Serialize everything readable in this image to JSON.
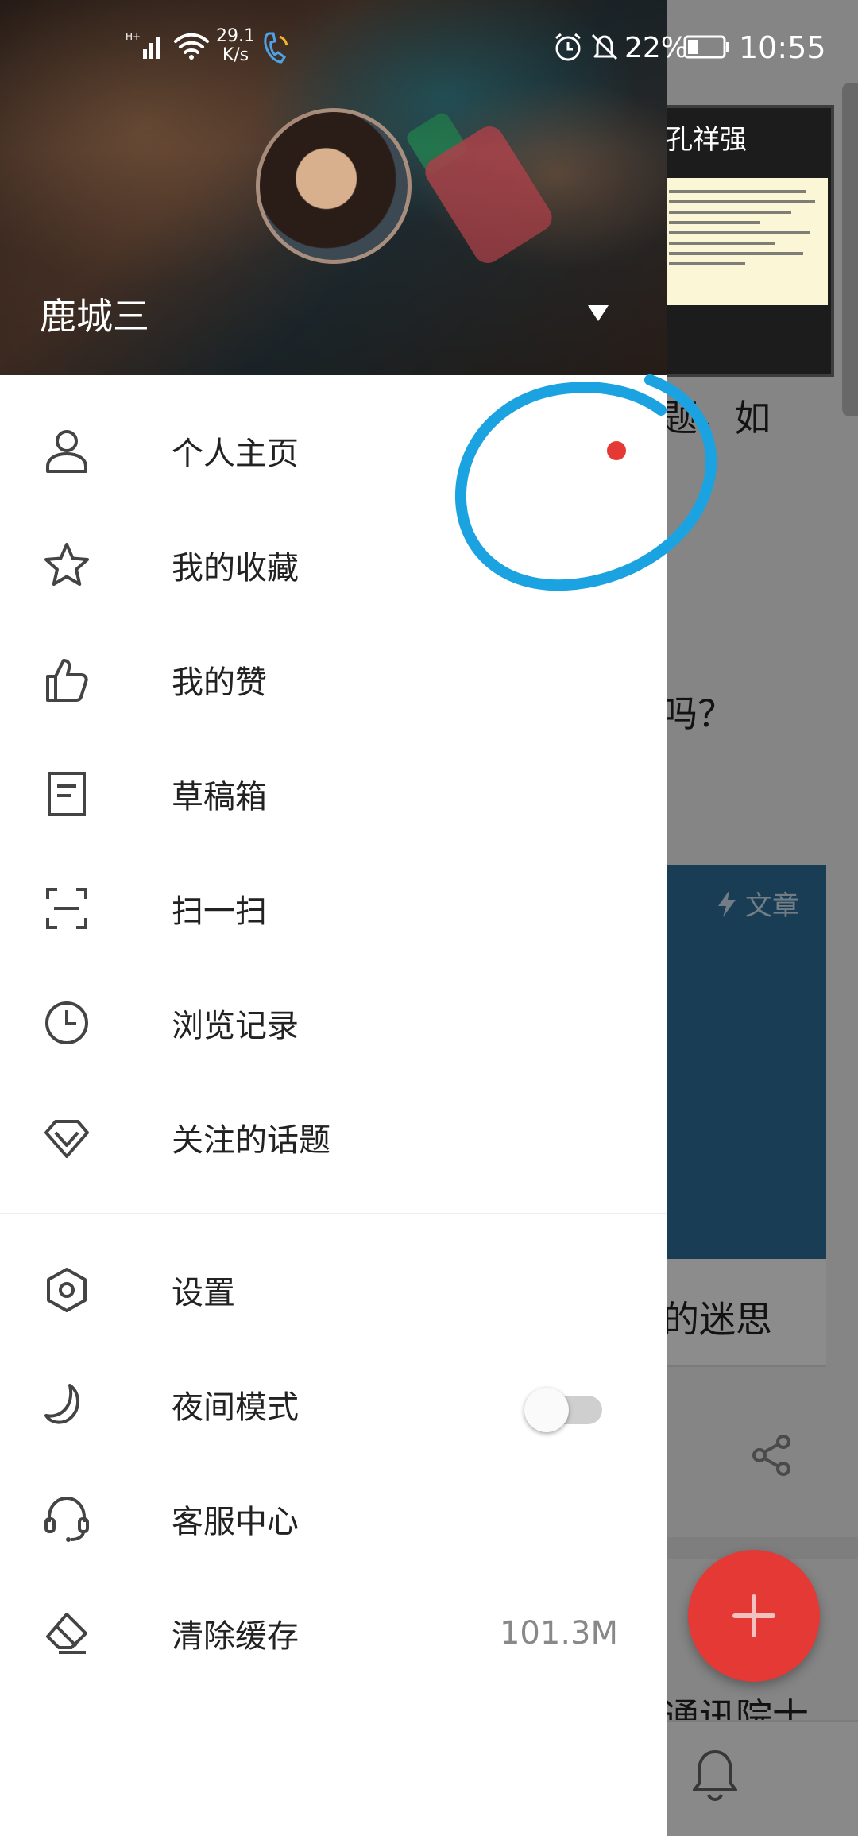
{
  "status_bar": {
    "speed_value": "29.1",
    "speed_unit": "K/s",
    "battery": "22%",
    "time": "10:55"
  },
  "drawer": {
    "username": "鹿城三",
    "menu": [
      {
        "label": "个人主页",
        "icon": "person-icon"
      },
      {
        "label": "我的收藏",
        "icon": "star-icon"
      },
      {
        "label": "我的赞",
        "icon": "thumbs-up-icon"
      },
      {
        "label": "草稿箱",
        "icon": "draft-icon"
      },
      {
        "label": "扫一扫",
        "icon": "scan-icon"
      },
      {
        "label": "浏览记录",
        "icon": "clock-icon"
      },
      {
        "label": "关注的话题",
        "icon": "diamond-icon"
      }
    ],
    "settings_menu": [
      {
        "label": "设置",
        "icon": "settings-hexagon-icon"
      },
      {
        "label": "夜间模式",
        "icon": "moon-icon",
        "toggle_on": false
      },
      {
        "label": "客服中心",
        "icon": "headset-icon"
      },
      {
        "label": "清除缓存",
        "icon": "eraser-icon",
        "value": "101.3M"
      }
    ]
  },
  "thumbnail": {
    "title": "孔祥强"
  },
  "background": {
    "fragment_1": "题，如",
    "fragment_2": "吗？",
    "card_badge": "文章",
    "fragment_3": "的迷思",
    "fragment_4": "通讯院士"
  },
  "colors": {
    "accent_red": "#e53935",
    "annotation_blue": "#1aa3e0"
  }
}
